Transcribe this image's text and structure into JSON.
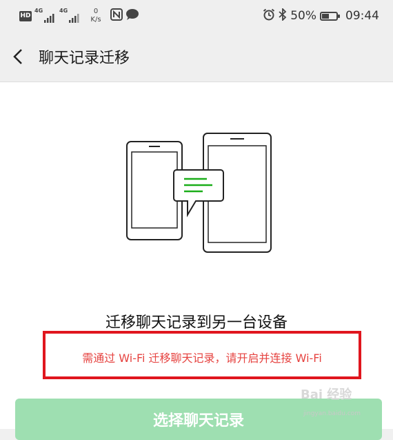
{
  "status_bar": {
    "hd": "HD",
    "sim1": "4G",
    "sim2": "4G",
    "speed_value": "0",
    "speed_unit": "K/s",
    "battery_text": "50%",
    "battery_level": 0.5,
    "time": "09:44",
    "icons": [
      "hd-icon",
      "signal-icon",
      "nfc-icon",
      "message-icon",
      "alarm-icon",
      "bluetooth-icon",
      "battery-icon"
    ]
  },
  "header": {
    "title": "聊天记录迁移",
    "back_icon": "back-arrow-icon"
  },
  "main": {
    "heading": "迁移聊天记录到另一台设备",
    "notice": "需通过 Wi-Fi 迁移聊天记录，请开启并连接 Wi-Fi",
    "button_label": "选择聊天记录"
  },
  "watermark": {
    "brand": "Bai 经验",
    "url": "jingyan.baidu.com"
  },
  "colors": {
    "accent_green": "#1aad19",
    "button_disabled": "#9edfb1",
    "warning_text": "#e64340",
    "highlight_border": "#e0161e"
  }
}
